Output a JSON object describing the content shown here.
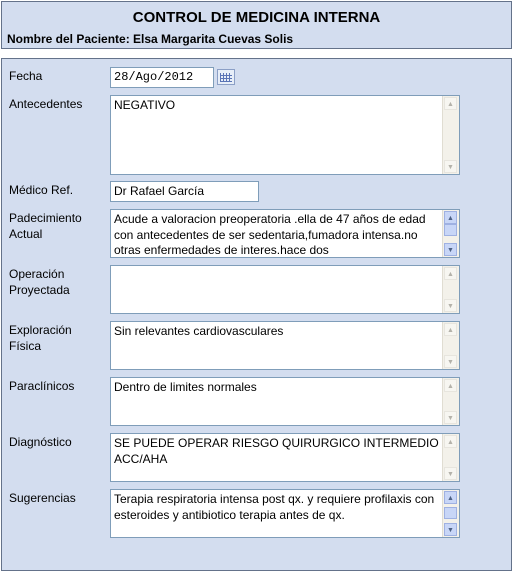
{
  "header": {
    "title": "CONTROL DE MEDICINA INTERNA",
    "patient": "Nombre del Paciente: Elsa Margarita Cuevas Solis"
  },
  "form": {
    "fecha": {
      "label": "Fecha",
      "value": "28/Ago/2012"
    },
    "antecedentes": {
      "label": "Antecedentes",
      "value": "NEGATIVO"
    },
    "medico_ref": {
      "label": "Médico Ref.",
      "value": "Dr Rafael García"
    },
    "padecimiento": {
      "label1": "Padecimiento",
      "label2": "Actual",
      "value": "Acude a valoracion preoperatoria .ella de 47 años de edad con antecedentes de ser sedentaria,fumadora intensa.no otras enfermedades de interes.hace dos"
    },
    "operacion": {
      "label1": "Operación",
      "label2": "Proyectada",
      "value": ""
    },
    "exploracion": {
      "label1": "Exploración",
      "label2": "Física",
      "value": "Sin relevantes cardiovasculares"
    },
    "paraclinicos": {
      "label": "Paraclínicos",
      "value": "Dentro de limites normales"
    },
    "diagnostico": {
      "label": "Diagnóstico",
      "value": "SE PUEDE OPERAR RIESGO QUIRURGICO INTERMEDIO ACC/AHA"
    },
    "sugerencias": {
      "label": "Sugerencias",
      "value": "Terapia respiratoria intensa post qx. y  requiere profilaxis con esteroides y antibiotico terapia antes de qx."
    }
  },
  "icons": {
    "calendar": "calendar-icon",
    "scroll_up": "scroll-up-arrow-icon",
    "scroll_down": "scroll-down-arrow-icon"
  }
}
